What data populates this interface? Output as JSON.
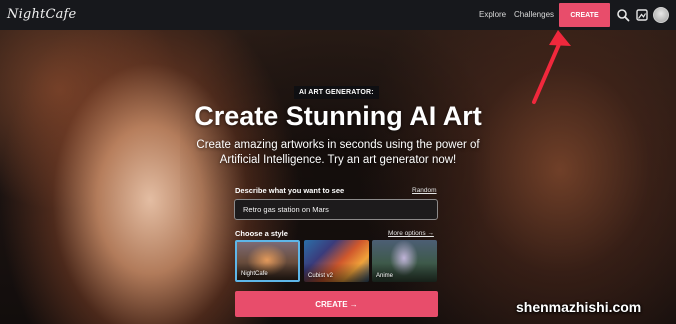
{
  "header": {
    "logo_text": "NightCafe",
    "nav_explore": "Explore",
    "nav_challenges": "Challenges",
    "create_label": "CREATE",
    "icons": [
      "search-icon",
      "gallery-icon",
      "avatar"
    ]
  },
  "hero": {
    "badge": "AI ART GENERATOR:",
    "headline": "Create Stunning AI Art",
    "subhead": "Create amazing artworks in seconds using the power of Artificial Intelligence. Try an art generator now!"
  },
  "form": {
    "describe_label": "Describe what you want to see",
    "random_label": "Random",
    "prompt_value": "Retro gas station on Mars",
    "style_label": "Choose a style",
    "more_options_label": "More options →",
    "styles": [
      {
        "name": "NightCafe",
        "selected": true
      },
      {
        "name": "Cubist v2",
        "selected": false
      },
      {
        "name": "Anime",
        "selected": false
      }
    ],
    "create_label": "CREATE →"
  },
  "watermark": "shenmazhishi.com",
  "colors": {
    "accent": "#e84d6b",
    "topbar": "#17181c",
    "selected_border": "#5eb6e8",
    "annotation_arrow": "#f0283c"
  }
}
